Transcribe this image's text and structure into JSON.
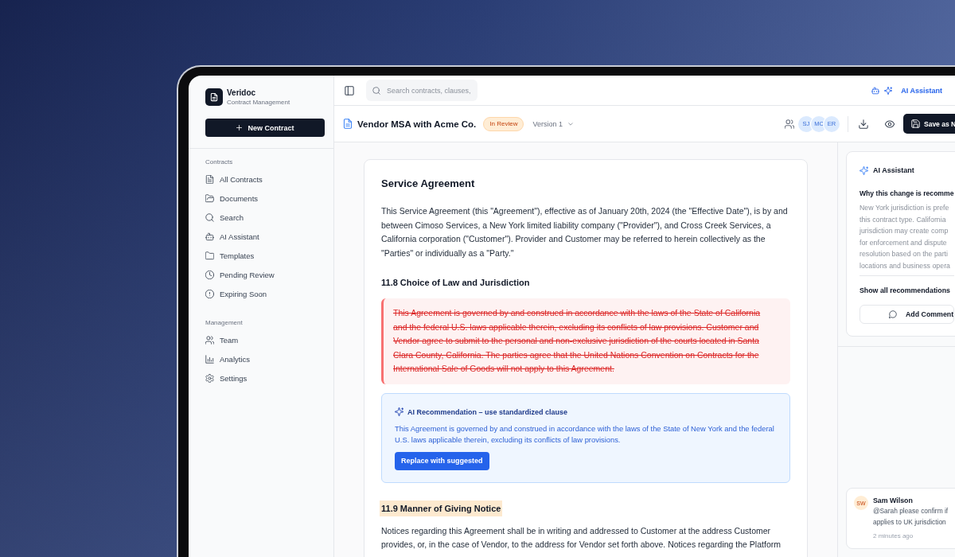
{
  "sidebar": {
    "brand": {
      "name": "Veridoc",
      "tagline": "Contract Management"
    },
    "new_button": "New Contract",
    "sections": [
      {
        "title": "Contracts",
        "items": [
          {
            "label": "All Contracts",
            "kind": "file",
            "selected": false
          },
          {
            "label": "Documents",
            "kind": "openfolder",
            "selected": false
          },
          {
            "label": "Search",
            "kind": "search",
            "selected": false
          },
          {
            "label": "AI Assistant",
            "kind": "robot",
            "selected": false
          },
          {
            "label": "Templates",
            "kind": "folder",
            "selected": false
          },
          {
            "label": "Pending Review",
            "kind": "clock",
            "selected": false
          },
          {
            "label": "Expiring Soon",
            "kind": "alert",
            "selected": false
          }
        ]
      },
      {
        "title": "Management",
        "items": [
          {
            "label": "Team",
            "kind": "users",
            "selected": false
          },
          {
            "label": "Analytics",
            "kind": "chart",
            "selected": false
          },
          {
            "label": "Settings",
            "kind": "gear",
            "selected": false
          }
        ]
      }
    ]
  },
  "top_bar": {
    "search": {
      "placeholder": "Search contracts, clauses,"
    },
    "assistant_button": "AI Assistant"
  },
  "document_header": {
    "title": "Vendor MSA with Acme Co.",
    "status": "In Review",
    "version": "Version 1",
    "collaborators": [
      {
        "initials": "SJ"
      },
      {
        "initials": "MC"
      },
      {
        "initials": "ER"
      }
    ],
    "save_button": "Save as N"
  },
  "document": {
    "title": "Service Agreement",
    "blocks": [
      {
        "kind": "paragraph",
        "text": "This Service Agreement (this \"Agreement\"), effective as of January 20th, 2024 (the \"Effective Date\"), is by and between Cimoso Services, a New York limited liability company (\"Provider\"), and Cross Creek Services, a California corporation (\"Customer\"). Provider and Customer may be referred to herein collectively as the \"Parties\" or individually as a \"Party.\""
      },
      {
        "kind": "heading",
        "text": "11.8 Choice of Law and Jurisdiction",
        "highlighted": false
      },
      {
        "kind": "deleted",
        "text": "This Agreement is governed by and construed in accordance with the laws of the State of California and the federal U.S. laws applicable therein, excluding its conflicts of law provisions. Customer and Vendor agree to submit to the personal and non-exclusive jurisdiction of the courts located in Santa Clara County, California. The parties agree that the United Nations Convention on Contracts for the International Sale of Goods will not apply to this Agreement."
      },
      {
        "kind": "suggestion",
        "title": "AI Recommendation – use standardized clause",
        "text": "This Agreement is governed by and construed in accordance with the laws of the State of New York and the federal U.S. laws applicable therein, excluding its conflicts of law provisions.",
        "button": "Replace with suggested"
      },
      {
        "kind": "heading",
        "text": "11.9 Manner of Giving Notice",
        "highlighted": true
      },
      {
        "kind": "paragraph",
        "text": "Notices regarding this Agreement shall be in writing and addressed to Customer at the address Customer provides, or, in the case of Vendor, to the address for Vendor set forth above. Notices regarding the Platform"
      }
    ]
  },
  "assistant_panel": {
    "card": {
      "title": "AI Assistant",
      "reason_title": "Why this change is recomme",
      "reason_lines": [
        "New York jurisdiction is prefe",
        "this contract type. California",
        "jurisdiction may create comp",
        "for enforcement and dispute",
        "resolution based on the parti",
        "locations and business opera"
      ],
      "show_all": "Show all recommendations",
      "comment_button": "Add Comment"
    },
    "comments": [
      {
        "initials": "SW",
        "author": "Sam Wilson",
        "lines": [
          "@Sarah please confirm if",
          "applies to UK jurisdiction"
        ],
        "time": "2 minutes ago"
      }
    ]
  }
}
